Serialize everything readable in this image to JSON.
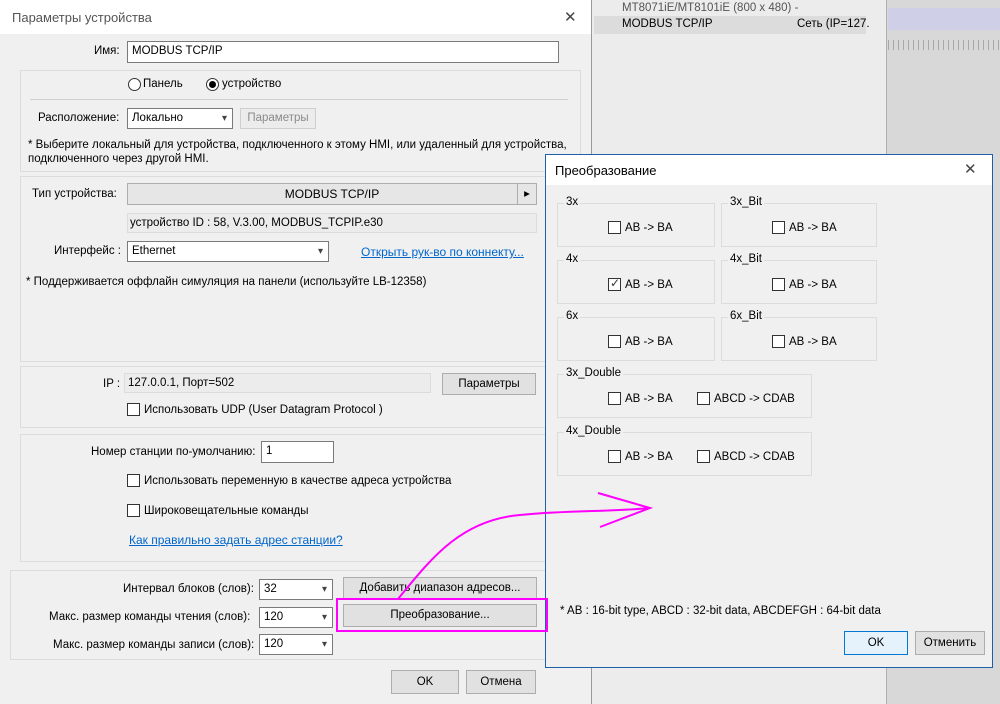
{
  "background": {
    "line1": "MT8071iE/MT8101iE (800 x 480)  -",
    "row_name": "MODBUS TCP/IP",
    "row_net": "Сеть (IP=127.",
    "accent": "#cfcfe8"
  },
  "main_dialog": {
    "title": "Параметры устройства",
    "name_label": "Имя:",
    "name_value": "MODBUS TCP/IP",
    "radio_panel": "Панель",
    "radio_device": "устройство",
    "location_label": "Расположение:",
    "location_value": "Локально",
    "location_params_btn": "Параметры",
    "location_note": "* Выберите локальный для устройства, подключенного к этому HMI, или удаленный для устройства, подключенного через другой HMI.",
    "device_type_label": "Тип устройства:",
    "device_type_value": "MODBUS TCP/IP",
    "device_info": "устройство ID : 58, V.3.00, MODBUS_TCPIP.e30",
    "interface_label": "Интерфейс :",
    "interface_value": "Ethernet",
    "connector_link": "Открыть рук-во по коннекту...",
    "offline_note": "* Поддерживается оффлайн симуляция на панели (используйте LB-12358)",
    "ip_label": "IP :",
    "ip_value": "127.0.0.1,  Порт=502",
    "ip_params_btn": "Параметры",
    "udp_label": "Использовать UDP (User Datagram Protocol )",
    "station_label": "Номер станции по-умолчанию:",
    "station_value": "1",
    "use_var_label": "Использовать переменную в качестве адреса устройства",
    "broadcast_label": "Широковещательные команды",
    "station_link": "Как правильно задать адрес станции?",
    "block_interval_label": "Интервал блоков (слов):",
    "block_interval_value": "32",
    "add_range_btn": "Добавить диапазон адресов...",
    "max_read_label": "Макс. размер команды чтения (слов):",
    "max_read_value": "120",
    "conversion_btn": "Преобразование...",
    "max_write_label": "Макс. размер команды записи (слов):",
    "max_write_value": "120",
    "ok_btn": "OK",
    "cancel_btn": "Отмена",
    "close_glyph": "✕"
  },
  "conversion_dialog": {
    "title": "Преобразование",
    "title_color": "#1e5fa8",
    "close_glyph": "✕",
    "groups": {
      "g3x": {
        "name": "3x",
        "opt1": "AB -> BA",
        "checked": false
      },
      "g3xbit": {
        "name": "3x_Bit",
        "opt1": "AB -> BA",
        "checked": false
      },
      "g4x": {
        "name": "4x",
        "opt1": "AB -> BA",
        "checked": true
      },
      "g4xbit": {
        "name": "4x_Bit",
        "opt1": "AB -> BA",
        "checked": false
      },
      "g6x": {
        "name": "6x",
        "opt1": "AB -> BA",
        "checked": false
      },
      "g6xbit": {
        "name": "6x_Bit",
        "opt1": "AB -> BA",
        "checked": false
      },
      "g3xd": {
        "name": "3x_Double",
        "opt1": "AB -> BA",
        "opt2": "ABCD -> CDAB"
      },
      "g4xd": {
        "name": "4x_Double",
        "opt1": "AB -> BA",
        "opt2": "ABCD -> CDAB"
      }
    },
    "note": "* AB : 16-bit type, ABCD : 32-bit data, ABCDEFGH : 64-bit data",
    "ok_btn": "OK",
    "cancel_btn": "Отменить"
  },
  "annotation": {
    "color": "#ff00ff",
    "check_glyph": "✓",
    "chevron": "▾",
    "play": "▸"
  }
}
